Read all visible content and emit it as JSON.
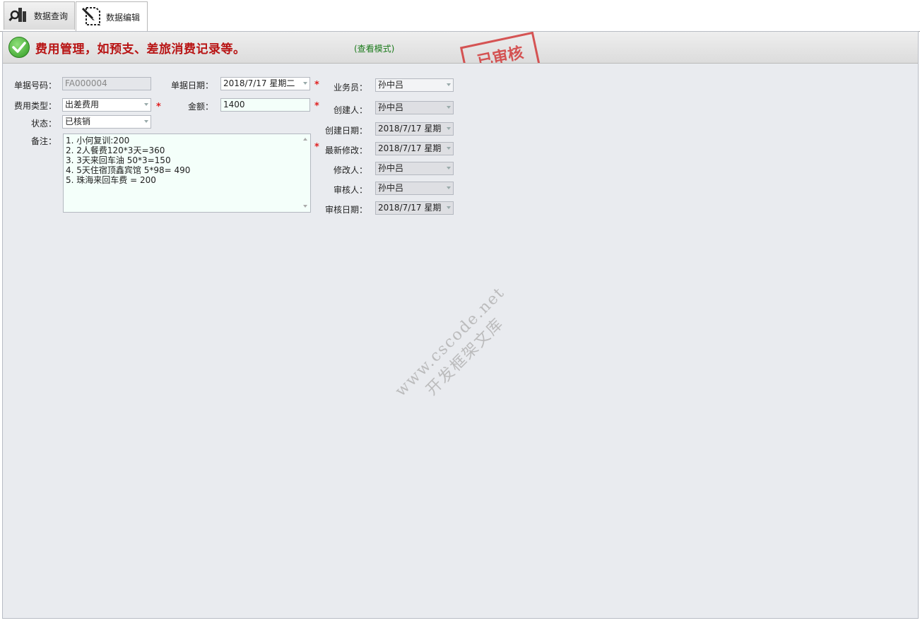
{
  "tabs": [
    {
      "label": "数据查询",
      "icon": "search-chart-icon",
      "active": false
    },
    {
      "label": "数据编辑",
      "icon": "edit-document-icon",
      "active": true
    }
  ],
  "banner": {
    "title": "费用管理，如预支、差旅消费记录等。",
    "mode": "(查看模式)",
    "stamp": "已审核"
  },
  "form": {
    "doc_no": {
      "label": "单据号码：",
      "value": "FA000004"
    },
    "doc_date": {
      "label": "单据日期：",
      "value": "2018/7/17 星期二"
    },
    "salesman": {
      "label": "业务员：",
      "value": "孙中吕"
    },
    "fee_type": {
      "label": "费用类型：",
      "value": "出差费用"
    },
    "amount": {
      "label": "金额：",
      "value": "1400"
    },
    "creator": {
      "label": "创建人：",
      "value": "孙中吕"
    },
    "status": {
      "label": "状态：",
      "value": "已核销"
    },
    "created_date": {
      "label": "创建日期：",
      "value": "2018/7/17 星期"
    },
    "remark": {
      "label": "备注：",
      "lines": [
        "1. 小何复训:200",
        "2. 2人餐费120*3天=360",
        "3. 3天来回车油 50*3=150",
        "4. 5天住宿顶鑫宾馆 5*98= 490",
        "5. 珠海来回车费 = 200"
      ]
    },
    "modified_date": {
      "label": "最新修改：",
      "value": "2018/7/17 星期"
    },
    "modifier": {
      "label": "修改人：",
      "value": "孙中吕"
    },
    "auditor": {
      "label": "审核人：",
      "value": "孙中吕"
    },
    "audit_date": {
      "label": "审核日期：",
      "value": "2018/7/17 星期"
    },
    "required_mark": "*"
  },
  "watermark": {
    "line1": "www.cscode.net",
    "line2": "开发框架文库"
  }
}
